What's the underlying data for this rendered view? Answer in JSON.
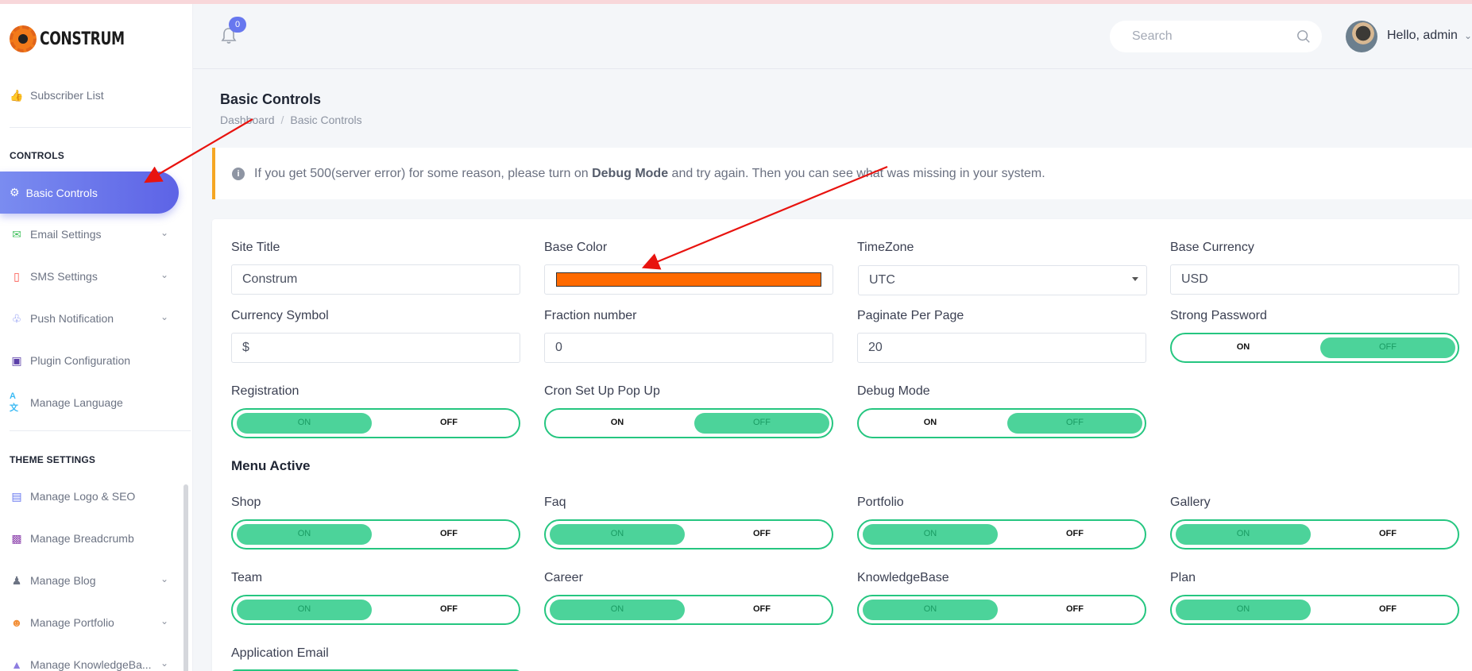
{
  "sidebar": {
    "logo_text": "CONSTRUM",
    "items_top": [
      {
        "label": "Subscriber List",
        "icon": "thumbs-up-icon"
      }
    ],
    "controls_title": "CONTROLS",
    "active_item": "Basic Controls",
    "controls_items": [
      {
        "label": "Email Settings",
        "icon": "envelope-icon"
      },
      {
        "label": "SMS Settings",
        "icon": "mobile-icon"
      },
      {
        "label": "Push Notification",
        "icon": "bell-icon"
      },
      {
        "label": "Plugin Configuration",
        "icon": "toolbox-icon"
      },
      {
        "label": "Manage Language",
        "icon": "language-icon"
      }
    ],
    "theme_title": "THEME SETTINGS",
    "theme_items": [
      {
        "label": "Manage Logo & SEO",
        "icon": "image-icon"
      },
      {
        "label": "Manage Breadcrumb",
        "icon": "file-image-icon"
      },
      {
        "label": "Manage Blog",
        "icon": "users-icon"
      },
      {
        "label": "Manage Portfolio",
        "icon": "user-circle-icon"
      },
      {
        "label": "Manage KnowledgeBa...",
        "icon": "graduation-cap-icon"
      }
    ]
  },
  "header": {
    "notification_count": "0",
    "search_placeholder": "Search",
    "greeting": "Hello, admin"
  },
  "page": {
    "title": "Basic Controls",
    "breadcrumb": [
      "Dashboard",
      "Basic Controls"
    ],
    "alert": {
      "before": "If you get 500(server error) for some reason, please turn on ",
      "bold": "Debug Mode",
      "after": " and try again. Then you can see what was missing in your system."
    }
  },
  "form": {
    "site_title": {
      "label": "Site Title",
      "value": "Construm"
    },
    "base_color": {
      "label": "Base Color",
      "value": "#ff6a00"
    },
    "timezone": {
      "label": "TimeZone",
      "value": "UTC"
    },
    "base_currency": {
      "label": "Base Currency",
      "value": "USD"
    },
    "currency_symbol": {
      "label": "Currency Symbol",
      "value": "$"
    },
    "fraction_number": {
      "label": "Fraction number",
      "value": "0"
    },
    "paginate_per_page": {
      "label": "Paginate Per Page",
      "value": "20"
    },
    "on_label": "ON",
    "off_label": "OFF",
    "strong_password": {
      "label": "Strong Password",
      "state": "off"
    },
    "registration": {
      "label": "Registration",
      "state": "on"
    },
    "cron_popup": {
      "label": "Cron Set Up Pop Up",
      "state": "off"
    },
    "debug_mode": {
      "label": "Debug Mode",
      "state": "off"
    },
    "menu_active_title": "Menu Active",
    "menu_shop": {
      "label": "Shop",
      "state": "on"
    },
    "menu_faq": {
      "label": "Faq",
      "state": "on"
    },
    "menu_portfolio": {
      "label": "Portfolio",
      "state": "on"
    },
    "menu_gallery": {
      "label": "Gallery",
      "state": "on"
    },
    "menu_team": {
      "label": "Team",
      "state": "on"
    },
    "menu_career": {
      "label": "Career",
      "state": "on"
    },
    "menu_knowledgebase": {
      "label": "KnowledgeBase",
      "state": "on"
    },
    "menu_plan": {
      "label": "Plan",
      "state": "on"
    },
    "application_email": {
      "label": "Application Email"
    }
  },
  "colors": {
    "accent": "#6777ef",
    "toggle": "#4cd39a",
    "alert_border": "#f5a623",
    "annotation": "#e8130f"
  }
}
